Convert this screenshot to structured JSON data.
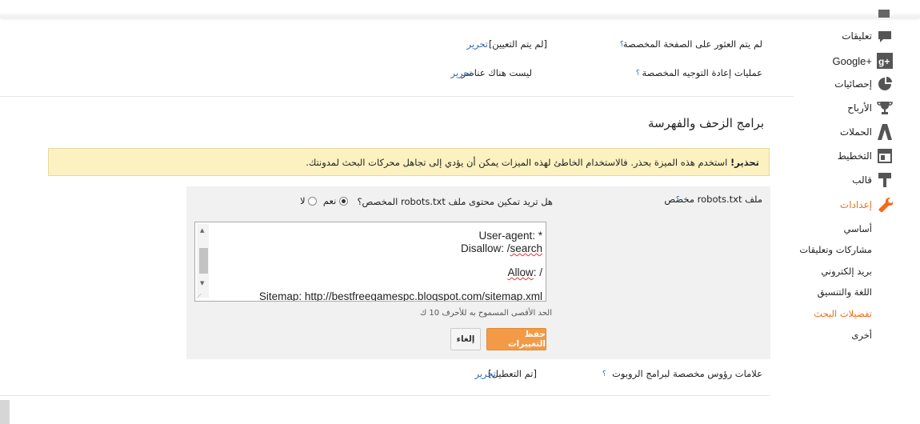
{
  "sidebar": {
    "items": [
      {
        "label": "تعليقات",
        "icon": "comment-icon"
      },
      {
        "label": "Google+",
        "icon": "google-plus-icon"
      },
      {
        "label": "إحصائيات",
        "icon": "pie-chart-icon"
      },
      {
        "label": "الأرباح",
        "icon": "trophy-icon"
      },
      {
        "label": "الحملات",
        "icon": "campaigns-icon"
      },
      {
        "label": "التخطيط",
        "icon": "layout-icon"
      },
      {
        "label": "قالب",
        "icon": "template-icon"
      },
      {
        "label": "إعدادات",
        "icon": "wrench-icon"
      }
    ],
    "subitems": [
      "أساسي",
      "مشاركات وتعليقات",
      "بريد إلكتروني",
      "اللغة والتنسيق",
      "تفضيلات البحث",
      "أخرى"
    ],
    "active_color": "#f26c1b"
  },
  "top_rows": [
    {
      "label": "لم يتم العثور على الصفحة المخصصة",
      "help": "؟",
      "value": "[لم يتم التعيين]",
      "edit": "تحرير"
    },
    {
      "label": "عمليات إعادة التوجيه المخصصة",
      "help": "؟",
      "value": "ليست هناك عناصر",
      "edit": "تحرير"
    }
  ],
  "section_title": "برامج الزحف والفهرسة",
  "warning": {
    "bold": "تحذير!",
    "text": " استخدم هذه الميزة بحذر. فالاستخدام الخاطئ لهذه الميزات يمكن أن يؤدي إلى تجاهل محركات البحث لمدونتك."
  },
  "robots": {
    "label": "ملف robots.txt مخصص",
    "help": "؟",
    "question": "هل تريد تمكين محتوى ملف robots.txt المخصص؟",
    "yes": "نعم",
    "no": "لا",
    "selected": "yes",
    "content": {
      "line1": "User-agent: *",
      "line2_a": "Disallow: /",
      "line2_b": "search",
      "line3_a": "Allow",
      "line3_b": ": /",
      "line4": "Sitemap: http://bestfreegamespc.blogspot.com/sitemap.xml"
    },
    "limit_note": "الحد الأقصى المسموح به للأحرف 10 ك",
    "save": "حفظ التغييرات",
    "cancel": "إلغاء"
  },
  "bottom_row": {
    "label": "علامات رؤوس مخصصة لبرامج الروبوت",
    "help": "؟",
    "value": "[تم التعطيل]",
    "edit": "تحرير"
  }
}
